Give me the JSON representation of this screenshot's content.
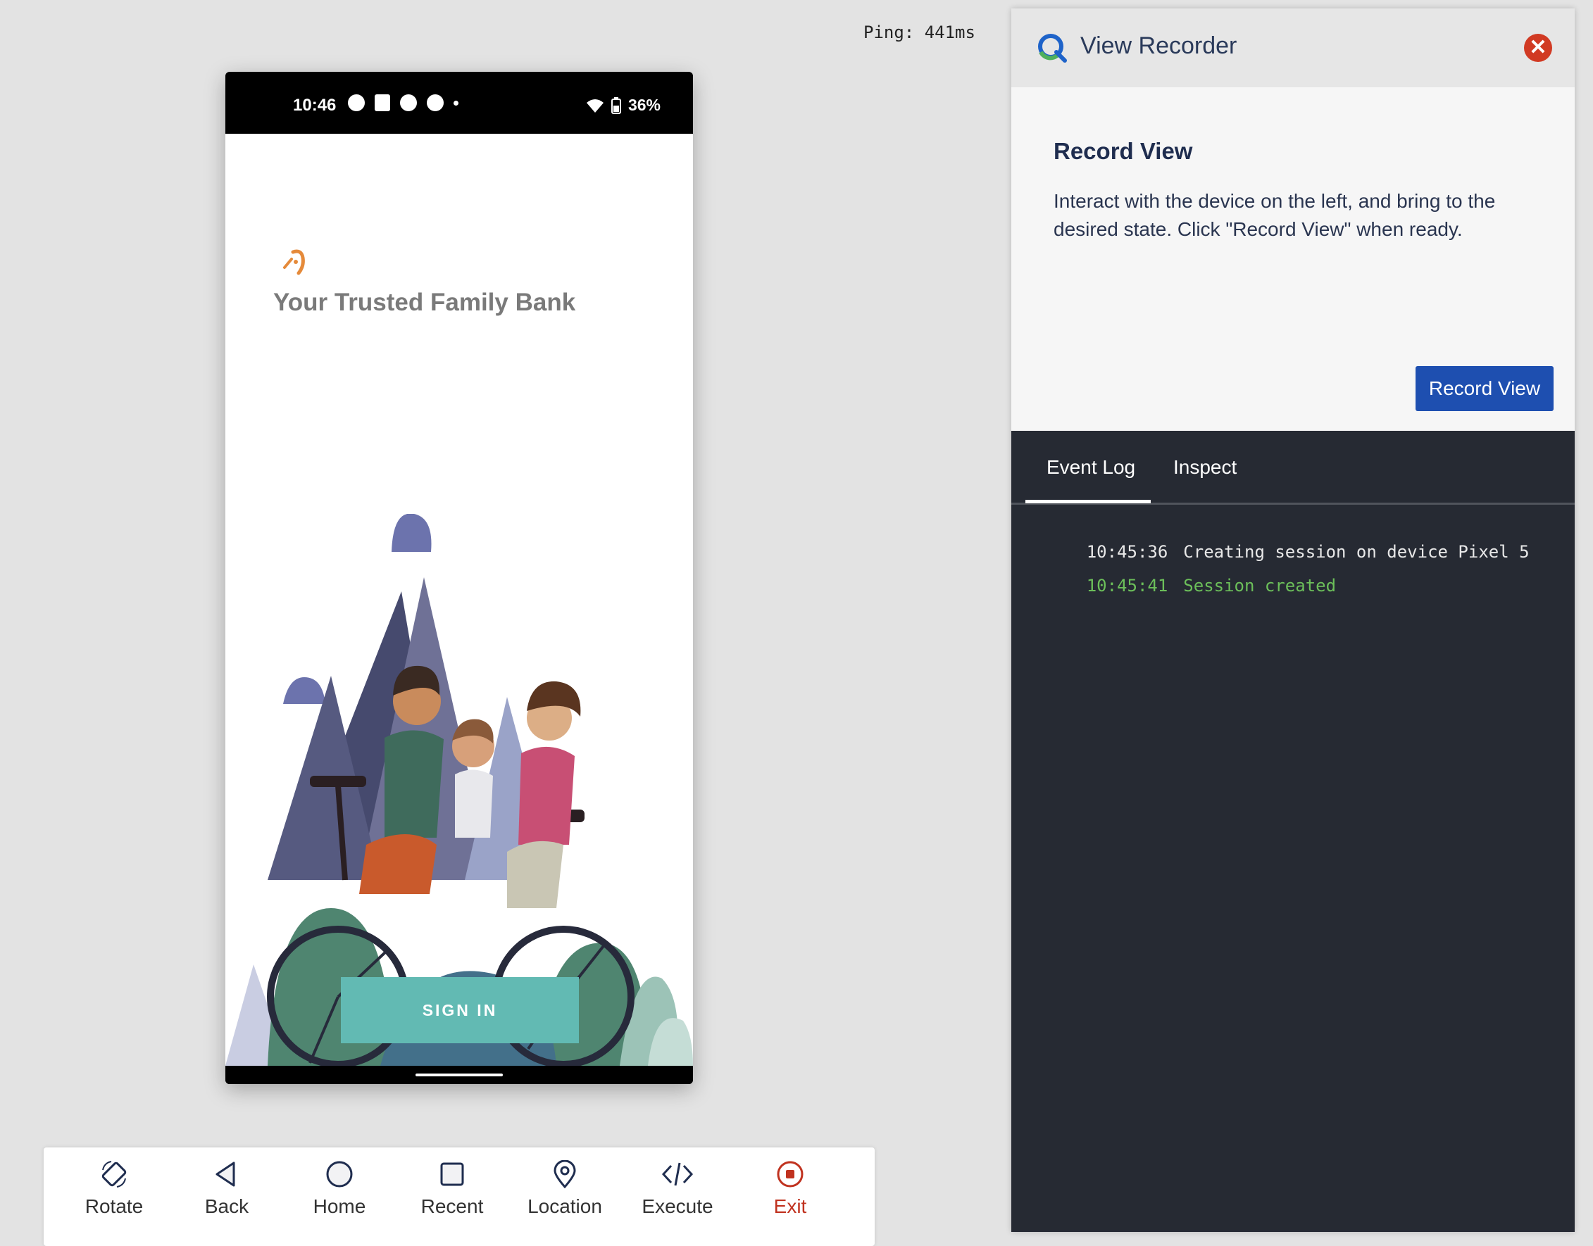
{
  "ping": "Ping: 441ms",
  "phone": {
    "status": {
      "time": "10:46",
      "battery": "36%"
    },
    "app": {
      "title": "Your Trusted Family Bank",
      "signin_label": "SIGN IN"
    }
  },
  "toolbar": {
    "items": [
      {
        "label": "Rotate",
        "icon": "rotate-icon"
      },
      {
        "label": "Back",
        "icon": "back-icon"
      },
      {
        "label": "Home",
        "icon": "home-icon"
      },
      {
        "label": "Recent",
        "icon": "recent-icon"
      },
      {
        "label": "Location",
        "icon": "location-icon"
      },
      {
        "label": "Execute",
        "icon": "code-icon"
      },
      {
        "label": "Exit",
        "icon": "stop-icon"
      }
    ]
  },
  "panel": {
    "title": "View Recorder",
    "close_symbol": "✕",
    "heading": "Record View",
    "description": "Interact with the device on the left, and bring to the desired state. Click \"Record View\" when ready.",
    "button_label": "Record View",
    "tabs": [
      {
        "label": "Event Log",
        "active": true
      },
      {
        "label": "Inspect",
        "active": false
      }
    ],
    "log": [
      {
        "time": "10:45:36",
        "message": "Creating session on device Pixel 5",
        "color": "#e8e8e8"
      },
      {
        "time": "10:45:41",
        "message": "Session created",
        "color": "#6cbf5a"
      }
    ]
  },
  "colors": {
    "accent": "#1e4fb0",
    "signin": "#62bab3",
    "exit": "#c0321f",
    "panel_dark": "#262a33"
  }
}
